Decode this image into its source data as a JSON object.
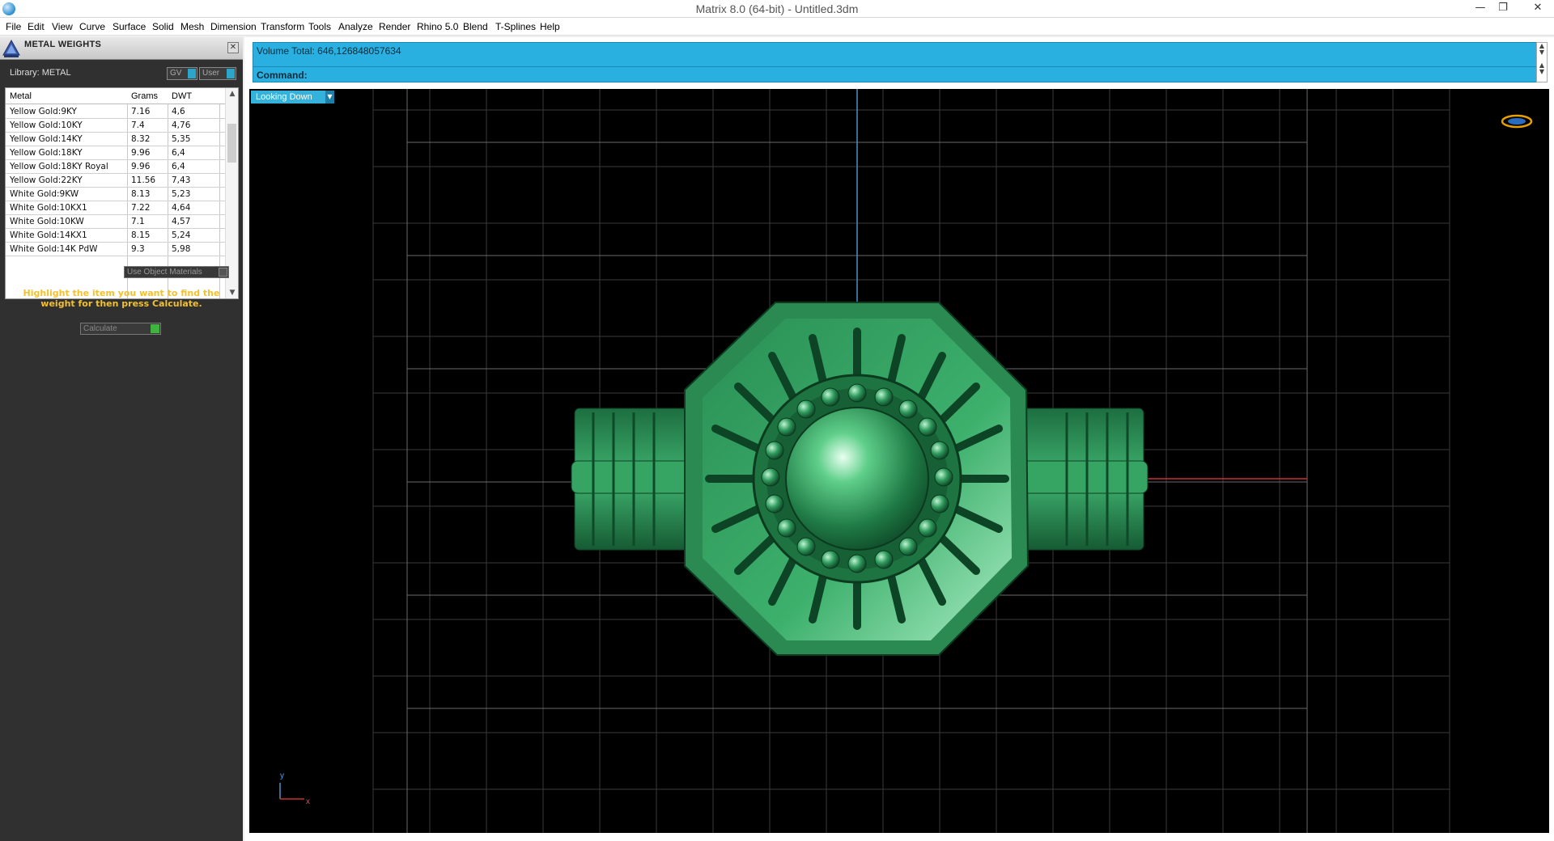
{
  "window": {
    "title": "Matrix 8.0 (64-bit) - Untitled.3dm",
    "controls": {
      "minimize": "—",
      "restore": "❐",
      "close": "✕"
    }
  },
  "menu": [
    "File",
    "Edit",
    "View",
    "Curve",
    "Surface",
    "Solid",
    "Mesh",
    "Dimension",
    "Transform",
    "Tools",
    "Analyze",
    "Render",
    "Rhino 5.0",
    "Blend",
    "T-Splines",
    "Help"
  ],
  "panel": {
    "title": "METAL WEIGHTS",
    "close": "✕",
    "library_label": "Library: METAL",
    "gv_label": "GV",
    "user_label": "User",
    "columns": [
      "Metal",
      "Grams",
      "DWT"
    ],
    "rows": [
      {
        "metal": "Yellow Gold:9KY",
        "grams": "7.16",
        "dwt": "4,6"
      },
      {
        "metal": "Yellow Gold:10KY",
        "grams": "7.4",
        "dwt": "4,76"
      },
      {
        "metal": "Yellow Gold:14KY",
        "grams": "8.32",
        "dwt": "5,35"
      },
      {
        "metal": "Yellow Gold:18KY",
        "grams": "9.96",
        "dwt": "6,4"
      },
      {
        "metal": "Yellow Gold:18KY Royal",
        "grams": "9.96",
        "dwt": "6,4"
      },
      {
        "metal": "Yellow Gold:22KY",
        "grams": "11.56",
        "dwt": "7,43"
      },
      {
        "metal": "White Gold:9KW",
        "grams": "8.13",
        "dwt": "5,23"
      },
      {
        "metal": "White Gold:10KX1",
        "grams": "7.22",
        "dwt": "4,64"
      },
      {
        "metal": "White Gold:10KW",
        "grams": "7.1",
        "dwt": "4,57"
      },
      {
        "metal": "White Gold:14KX1",
        "grams": "8.15",
        "dwt": "5,24"
      },
      {
        "metal": "White Gold:14K PdW",
        "grams": "9.3",
        "dwt": "5,98"
      }
    ],
    "use_object_materials": "Use Object Materials",
    "hint": "Highlight the item you want to find the weight for then press Calculate.",
    "calculate": "Calculate"
  },
  "command": {
    "volume_line": "Volume Total: 646,126848057634",
    "command_label": "Command:"
  },
  "viewport": {
    "view_name": "Looking Down",
    "axis_y": "y",
    "axis_x": "x"
  },
  "colors": {
    "panel_bg": "#303030",
    "hint": "#f2c12e",
    "command_bg": "#2ab0e0",
    "model_green": "#2d9a5a"
  }
}
